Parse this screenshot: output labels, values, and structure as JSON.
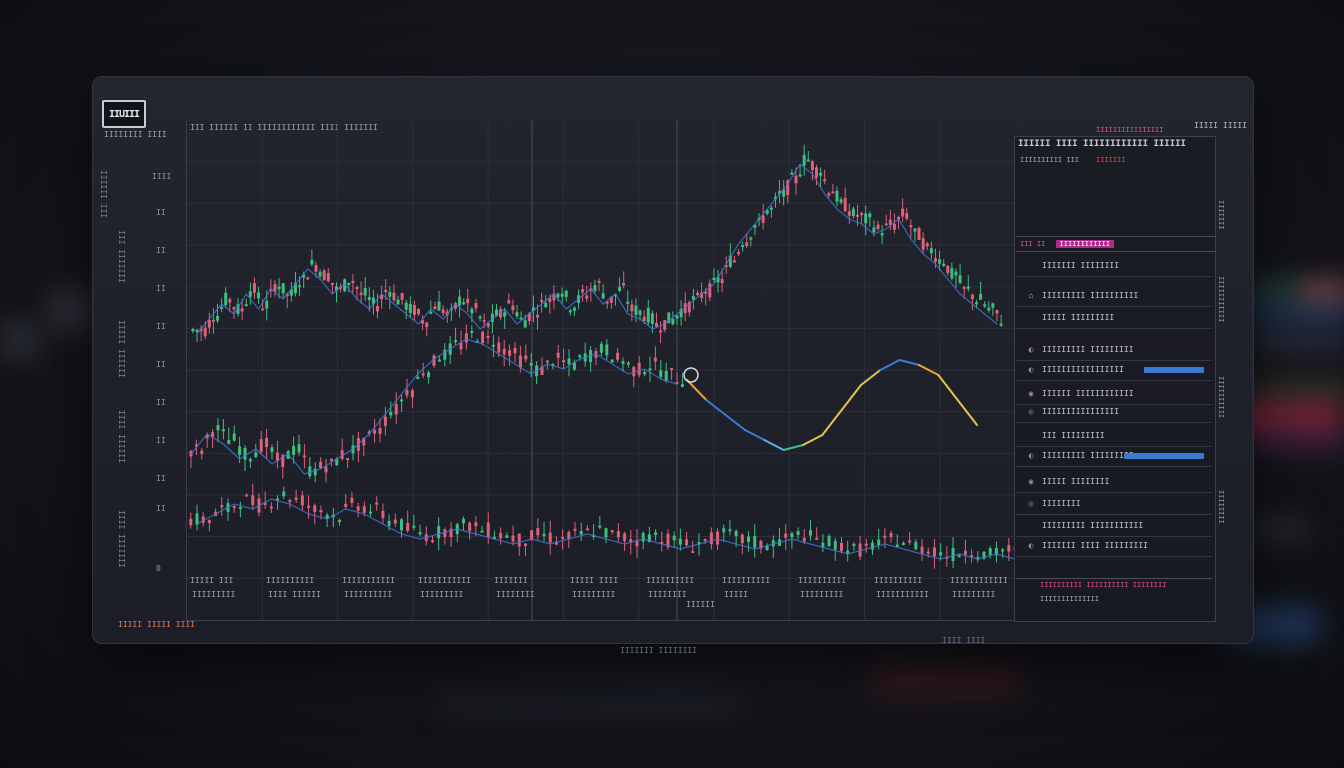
{
  "app": {
    "logo_text": "IIUIII",
    "logo_sub": "IIIIIIII IIII",
    "top_info": "III IIIIII II IIIIIIIIIIII IIII IIIIIII",
    "top_right_info": "IIIII IIIII",
    "pink_label": "IIIIIIIIIIIIIIII",
    "bottom_left_label": "IIIII IIIII IIII"
  },
  "colors": {
    "up": "#3fbf7f",
    "down": "#e0607a",
    "accent_pink": "#e04c86",
    "accent_blue": "#3a7bd5",
    "line_yellow": "#e8c14a",
    "grid": "#2c2f3a"
  },
  "left_rail": {
    "labels": [
      "III IIIIII",
      "IIIIIII III",
      "IIIIII IIIII",
      "IIIIII IIII",
      "IIIIIII IIII"
    ],
    "ticks": [
      "IIII",
      "II",
      "II",
      "II",
      "II",
      "II",
      "II",
      "II",
      "II",
      "II",
      "II",
      "II",
      "0"
    ]
  },
  "x_axis": {
    "row1": [
      "IIIII III",
      "IIIIIIIIII",
      "IIIIIIIIIII",
      "IIIIIIIIIII",
      "IIIIIII",
      "IIIII IIII",
      "IIIIIIIIII",
      "IIIIIIIIII",
      "IIIIIIIIII",
      "IIIIIIIIII",
      "IIIIIIIIIIII"
    ],
    "row2": [
      "IIIIIIIII",
      "IIII IIIIII",
      "IIIIIIIIII",
      "IIIIIIIII",
      "IIIIIIII",
      "IIIIIIIII",
      "IIIIIIII",
      "IIIII",
      "IIIIIIIII",
      "IIIIIIIIIII",
      "IIIIIIIII"
    ],
    "sub_label": "IIIIII"
  },
  "side_panel": {
    "header": "IIIIII  IIII IIIIIIIIIIII  IIIIII",
    "sub": "IIIIIIIIII  III",
    "sub_red": "IIIIIII",
    "tab_label": "III II",
    "tab_highlight": "IIIIIIIIIIII",
    "rows": [
      {
        "icon": "",
        "label": "IIIIIII IIIIIIII"
      },
      {
        "icon": "⌂",
        "label": "IIIIIIIII IIIIIIIIII"
      },
      {
        "icon": "",
        "label": "IIIII IIIIIIIII"
      },
      {
        "icon": "◐",
        "label": "IIIIIIIII IIIIIIIII"
      },
      {
        "icon": "◐",
        "label": "IIIIIIIIIIIIIIIII"
      },
      {
        "icon": "◉",
        "label": "IIIIII IIIIIIIIIIII"
      },
      {
        "icon": "◎",
        "label": "IIIIIIIIIIIIIIII"
      },
      {
        "icon": "",
        "label": "III IIIIIIIII"
      },
      {
        "icon": "◐",
        "label": "IIIIIIIII IIIIIIIII"
      },
      {
        "icon": "◉",
        "label": "IIIII IIIIIIII"
      },
      {
        "icon": "◎",
        "label": "IIIIIIII"
      },
      {
        "icon": "",
        "label": "IIIIIIIII IIIIIIIIIII"
      },
      {
        "icon": "◐",
        "label": "IIIIIII IIII IIIIIIIII"
      }
    ],
    "footer1": "IIIIIIIIII IIIIIIIIII IIIIIIII",
    "footer2": "IIIIIIIIIIIIII"
  },
  "right_strip": {
    "labels": [
      "IIIIIII",
      "IIIIIIIIIII",
      "IIIIIIIIII",
      "IIIIIIII"
    ]
  },
  "bottom": {
    "left_label": "IIIIIII IIIIIIII",
    "right_label": "IIII IIII"
  },
  "chart_data": {
    "type": "line",
    "title": "",
    "xlabel": "",
    "ylabel": "",
    "ylim": [
      0,
      100
    ],
    "grid": true,
    "series": [
      {
        "name": "",
        "kind": "candles",
        "values": [
          58,
          61,
          64,
          62,
          66,
          63,
          67,
          65,
          68,
          71,
          69,
          66,
          68,
          65,
          63,
          66,
          64,
          62,
          60,
          63,
          61,
          64,
          62,
          59,
          61,
          63,
          60,
          62,
          64,
          66,
          63,
          65,
          67,
          64,
          66,
          62,
          61,
          59,
          60,
          62,
          64,
          66,
          68,
          72,
          76,
          79,
          82,
          85,
          88,
          92,
          90,
          86,
          83,
          81,
          80,
          78,
          79,
          81,
          77,
          74,
          72,
          69,
          66,
          64,
          62,
          60
        ]
      },
      {
        "name": "",
        "kind": "candles",
        "values": [
          34,
          38,
          36,
          33,
          35,
          32,
          34,
          30,
          31,
          33,
          35,
          38,
          42,
          46,
          50,
          53,
          55,
          57,
          56,
          54,
          52,
          50,
          52,
          51,
          53,
          54,
          52,
          50,
          51,
          49,
          48
        ]
      },
      {
        "name": "",
        "kind": "line",
        "values": [
          48,
          44,
          41,
          38,
          36,
          34,
          35,
          37,
          42,
          47,
          50,
          52,
          51,
          49,
          44,
          39
        ]
      },
      {
        "name": "",
        "kind": "candles",
        "values": [
          20,
          22,
          24,
          23,
          25,
          24,
          22,
          21,
          23,
          22,
          20,
          18,
          17,
          18,
          19,
          18,
          17,
          16,
          17,
          16,
          17,
          18,
          17,
          16,
          17,
          16,
          15,
          16,
          17,
          16,
          15,
          16,
          17,
          16,
          15,
          14,
          15,
          16,
          15,
          14,
          13,
          14,
          13,
          14,
          13
        ]
      }
    ]
  }
}
